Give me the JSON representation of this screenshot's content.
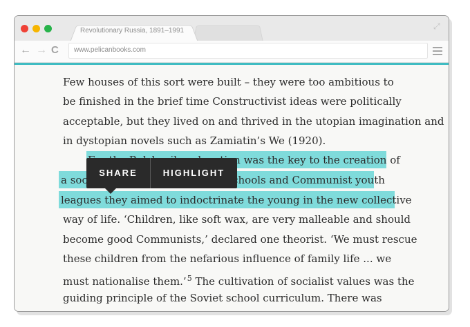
{
  "browser": {
    "tab_title": "Revolutionary Russia, 1891–1991",
    "url": "www.pelicanbooks.com",
    "controls": {
      "back_icon": "←",
      "forward_icon": "→",
      "reload_icon": "C",
      "menu_icon": "hamburger-icon",
      "expand_icon": "⤢"
    },
    "window_buttons": {
      "close_color": "#ef4136",
      "minimize_color": "#f6b500",
      "zoom_color": "#27b34a"
    }
  },
  "colors": {
    "accent": "#3fbcc2",
    "highlight": "#7fdbdb",
    "popup_bg": "#2a2a2a"
  },
  "article": {
    "lines": [
      "Few houses of this sort were built – they were too ambitious to",
      "be finished in the brief time Constructivist ideas were politically",
      "acceptable, but they lived on and thrived in the utopian imagination and",
      "in dystopian novels such as Zamiatin’s We (1920).",
      "For the Bolsheviks education was the key to the creation of",
      "a socialist society. Through the schools and Communist youth",
      "leagues they aimed to indoctrinate the young in the new collective",
      "way of life. ‘Children, like soft wax, are very malleable and should",
      "become good Communists,’ declared one theorist. ‘We must rescue",
      "these children from the nefarious influence of family life ... we",
      "must nationalise them.’",
      "5",
      "The cultivation of socialist values was the",
      "guiding principle of the Soviet school curriculum. There was"
    ]
  },
  "popup": {
    "share_label": "SHARE",
    "highlight_label": "HIGHLIGHT"
  }
}
